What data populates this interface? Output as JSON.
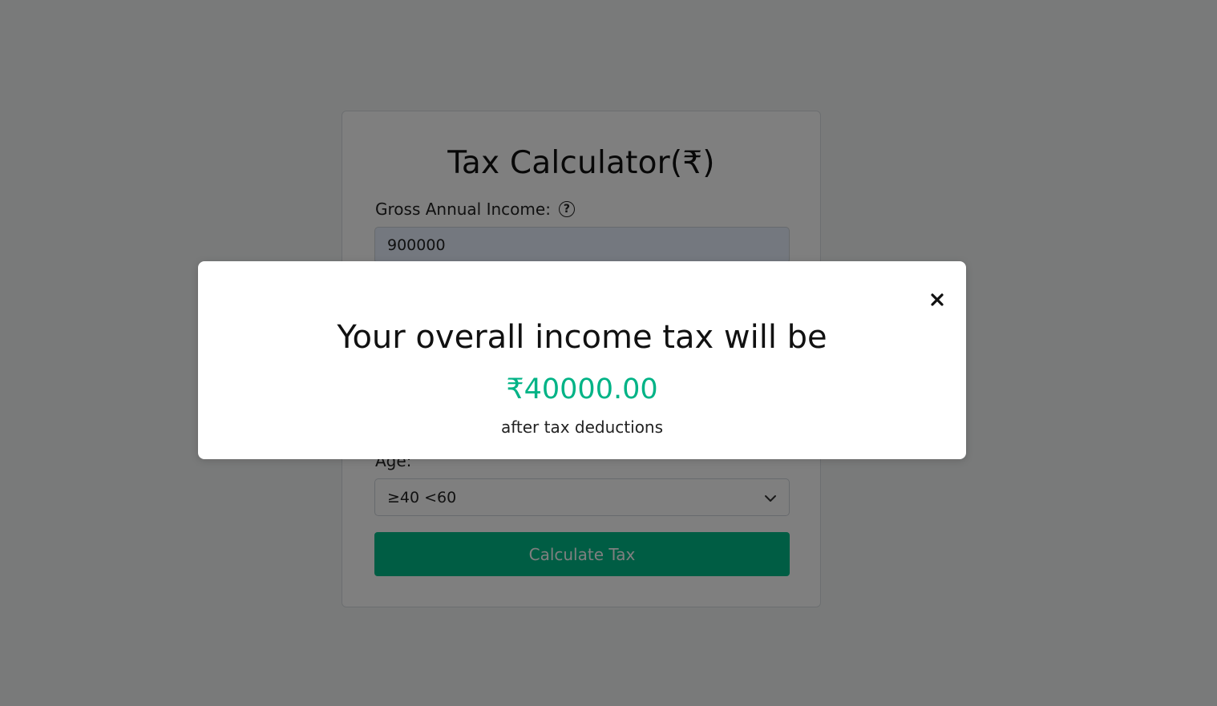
{
  "calculator": {
    "title": "Tax Calculator(₹)",
    "income_label": "Gross Annual Income:",
    "help_icon": "?",
    "income_value": "900000",
    "age_label": "Age:",
    "age_value": "≥40 <60",
    "calculate_label": "Calculate Tax"
  },
  "modal": {
    "heading": "Your overall income tax will be",
    "amount": "₹40000.00",
    "subtext": "after tax deductions",
    "close_icon": "close-icon"
  },
  "colors": {
    "accent": "#00ba88",
    "amount_text": "#00b386",
    "overlay": "rgba(0,0,0,0.5)"
  }
}
